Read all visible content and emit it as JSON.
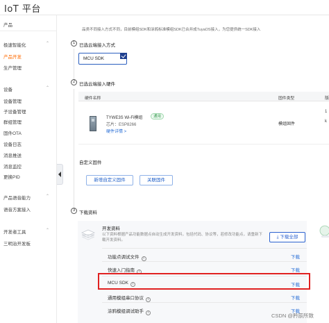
{
  "header": {
    "logo": "IoT 平台"
  },
  "sidebar": {
    "product_section": "产品",
    "items_top": [
      "极速智能化",
      "产品开发",
      "生产管理"
    ],
    "device_section": "设备",
    "items_device": [
      "设备管理",
      "子设备管理",
      "群组管理",
      "固件OTA",
      "设备日志",
      "消息推送",
      "消息监控",
      "更换PID"
    ],
    "voice_section": "产品语音能力",
    "items_voice": [
      "语音方案接入"
    ],
    "dev_section": "开发者工具",
    "items_dev": [
      "三明治开发板"
    ]
  },
  "notice": "品类不同接入方式不同，目前模组SDK和涂鸦标准模组SDK已合并成TuyaOS接入，为您提供统一SDK接入",
  "step1": {
    "num": "1",
    "title": "已选云端接入方式",
    "selected": "MCU SDK"
  },
  "step2": {
    "num": "2",
    "title": "已选云端接入硬件",
    "columns": [
      "硬件名称",
      "固件类型"
    ],
    "hardware": {
      "name": "TYWE3S Wi-Fi模组",
      "badge": "通用",
      "chip": "芯片：ESP8266",
      "link": "硬件详情 >",
      "firmware_type": "模组固件"
    },
    "right_col_chars": [
      "版",
      "1",
      "k"
    ],
    "custom_firmware": "自定义固件",
    "buttons": [
      "新增自定义固件",
      "关联固件"
    ]
  },
  "step3": {
    "num": "3",
    "title": "下载资料",
    "card_title": "开发资料",
    "card_desc": "以下资料根据产品功能数据点自动生成开发资料，包括代码、协议等，若修改功能点，请重新下载开发资料。",
    "download_all": "下载全部",
    "rows": [
      {
        "name": "功能点调试文件",
        "action": "下载"
      },
      {
        "name": "快速入门指南",
        "action": "下载"
      },
      {
        "name": "MCU SDK",
        "action": "下载"
      },
      {
        "name": "通用模组串口协议",
        "action": "下载"
      },
      {
        "name": "涂鸦模组调试助手",
        "action": "下载"
      }
    ]
  },
  "watermark": "CSDN @矜辰所致",
  "colors": {
    "accent": "#ff6a00",
    "link": "#2a6fd6",
    "highlight": "#e02020"
  }
}
